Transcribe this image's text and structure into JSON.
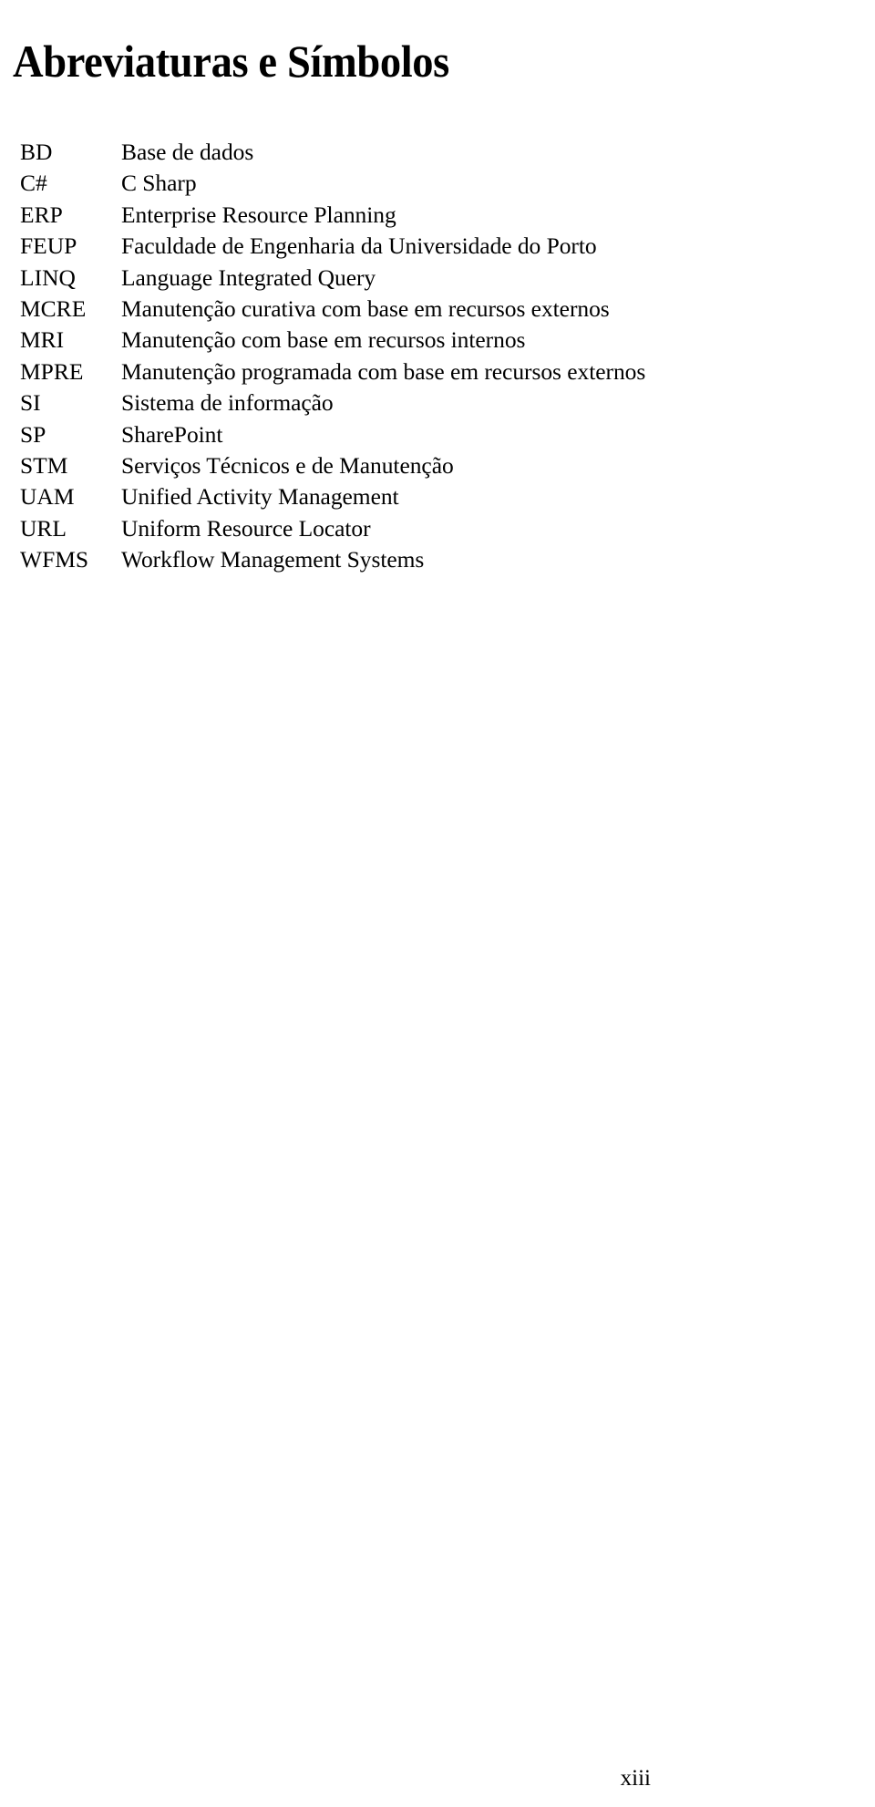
{
  "document": {
    "heading": "Abreviaturas e Símbolos",
    "page_number": "xiii"
  },
  "abbreviations": [
    {
      "abbr": "BD",
      "definition": "Base de dados"
    },
    {
      "abbr": "C#",
      "definition": "C Sharp"
    },
    {
      "abbr": "ERP",
      "definition": "Enterprise Resource Planning"
    },
    {
      "abbr": "FEUP",
      "definition": "Faculdade de Engenharia da Universidade do Porto"
    },
    {
      "abbr": "LINQ",
      "definition": "Language Integrated Query"
    },
    {
      "abbr": "MCRE",
      "definition": "Manutenção curativa com base em recursos externos"
    },
    {
      "abbr": "MRI",
      "definition": "Manutenção com base em recursos internos"
    },
    {
      "abbr": "MPRE",
      "definition": "Manutenção programada com base em recursos externos"
    },
    {
      "abbr": "SI",
      "definition": "Sistema de informação"
    },
    {
      "abbr": "SP",
      "definition": "SharePoint"
    },
    {
      "abbr": "STM",
      "definition": "Serviços Técnicos e de Manutenção"
    },
    {
      "abbr": "UAM",
      "definition": "Unified Activity Management"
    },
    {
      "abbr": "URL",
      "definition": "Uniform Resource Locator"
    },
    {
      "abbr": "WFMS",
      "definition": "Workflow Management Systems"
    }
  ]
}
